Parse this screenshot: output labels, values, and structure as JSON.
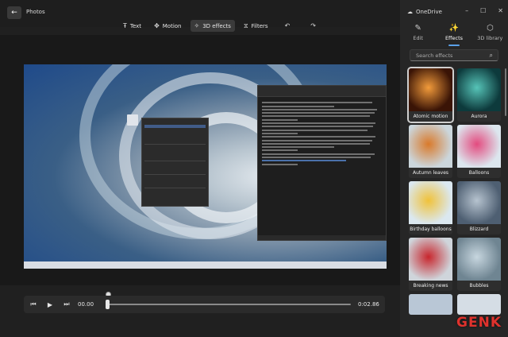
{
  "app": {
    "title": "Photos",
    "back_glyph": "←"
  },
  "toolbar": {
    "text_label": "Text",
    "motion_label": "Motion",
    "effects3d_label": "3D effects",
    "filters_label": "Filters"
  },
  "player": {
    "current_time": "00.00",
    "end_time": "0:02.86",
    "progress": 0.0
  },
  "side": {
    "title": "OneDrive",
    "tabs": [
      {
        "label": "Edit",
        "icon": "pencil-icon"
      },
      {
        "label": "Effects",
        "icon": "sparkle-wand-icon"
      },
      {
        "label": "3D library",
        "icon": "cube-icon"
      }
    ],
    "active_tab": "Effects",
    "search_placeholder": "Search effects"
  },
  "effects": [
    {
      "label": "Atomic motion",
      "colors": [
        "#3a1406",
        "#f29b3b"
      ],
      "selected": true
    },
    {
      "label": "Aurora",
      "colors": [
        "#0d3a3c",
        "#56c4b8"
      ],
      "selected": false
    },
    {
      "label": "Autumn leaves",
      "colors": [
        "#cbd6dc",
        "#d97a2b"
      ],
      "selected": false
    },
    {
      "label": "Balloons",
      "colors": [
        "#dce6ee",
        "#e34b7f"
      ],
      "selected": false
    },
    {
      "label": "Birthday balloons",
      "colors": [
        "#dbe8f0",
        "#f0c23a"
      ],
      "selected": false
    },
    {
      "label": "Blizzard",
      "colors": [
        "#4e5f72",
        "#b6c3cf"
      ],
      "selected": false
    },
    {
      "label": "Breaking news",
      "colors": [
        "#cfd5db",
        "#c8262d"
      ],
      "selected": false
    },
    {
      "label": "Bubbles",
      "colors": [
        "#6f8592",
        "#c7d6df"
      ],
      "selected": false
    }
  ],
  "watermark": {
    "prefix": "GEN",
    "suffix": "K"
  }
}
